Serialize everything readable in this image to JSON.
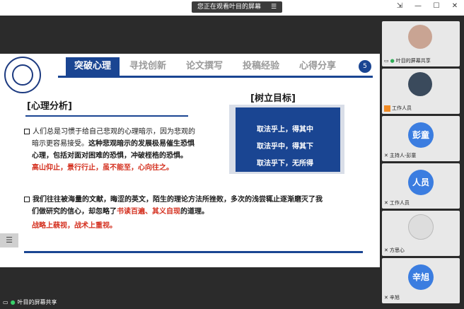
{
  "titlebar": {
    "share_banner_text": "您正在观看叶目的屏幕",
    "share_banner_menu_glyph": "☰",
    "controls": [
      "⇲",
      "—",
      "☐",
      "✕"
    ]
  },
  "slide": {
    "tabs": [
      {
        "label": "突破心理",
        "active": true
      },
      {
        "label": "寻找创新",
        "active": false
      },
      {
        "label": "论文撰写",
        "active": false
      },
      {
        "label": "投稿经验",
        "active": false
      },
      {
        "label": "心得分享",
        "active": false
      }
    ],
    "page_number": "5",
    "section_title": "[心理分析]",
    "goal_title": "[树立目标]",
    "goal_lines": [
      "取法乎上，得其中",
      "取法乎中，得其下",
      "取法乎下，无所得"
    ],
    "para1_line1": "人们总是习惯于给自己悲观的心理暗示，因为悲观的",
    "para1_line2": "暗示更容易接受。",
    "para1_line2_bold": "这种悲观暗示的发展极易催生恐惧",
    "para1_line3_bold": "心理，包括对面对困难的恐惧，冲破桎梏的恐惧。",
    "para1_red": "高山仰止，景行行止，虽不能至，心向往之。",
    "para2_line1": "我们往往被海量的文献，晦涩的英文，陌生的理论方法所挫败，多次的浅尝辄止逐渐磨灭了我",
    "para2_line2_a": "们做研究的信心，却忽略了",
    "para2_line2_red": "书读百遍、其义自现",
    "para2_line2_b": "的道理。",
    "para2_red": "战略上藐视，战术上重视。"
  },
  "side_handle_glyph": "☰",
  "bottom_bar": {
    "label": "叶目的屏幕共享"
  },
  "participants": [
    {
      "name": "叶目的屏幕共享",
      "avatar_type": "image",
      "avatar_color": "#c9a493",
      "icons": [
        "screen-icon",
        "mic-icon"
      ]
    },
    {
      "name": "工作人员",
      "avatar_type": "image",
      "avatar_color": "#3a4a5c",
      "icons": [
        "host-badge-icon"
      ]
    },
    {
      "name": "主持人-彭童",
      "avatar_type": "text",
      "avatar_text": "彭童",
      "avatar_color": "#3b7de0",
      "icons": [
        "mic-off-icon"
      ]
    },
    {
      "name": "工作人员",
      "avatar_type": "text",
      "avatar_text": "人员",
      "avatar_color": "#3b7de0",
      "icons": [
        "mic-off-icon"
      ]
    },
    {
      "name": "方思心",
      "avatar_type": "image",
      "avatar_color": "#dddddd",
      "icons": [
        "mic-off-icon"
      ]
    },
    {
      "name": "辛旭",
      "avatar_type": "text",
      "avatar_text": "辛旭",
      "avatar_color": "#3b7de0",
      "icons": [
        "mic-off-icon"
      ]
    }
  ],
  "colors": {
    "accent": "#1a4592",
    "highlight": "#d4301f",
    "sidebar_avatar": "#3b7de0"
  }
}
